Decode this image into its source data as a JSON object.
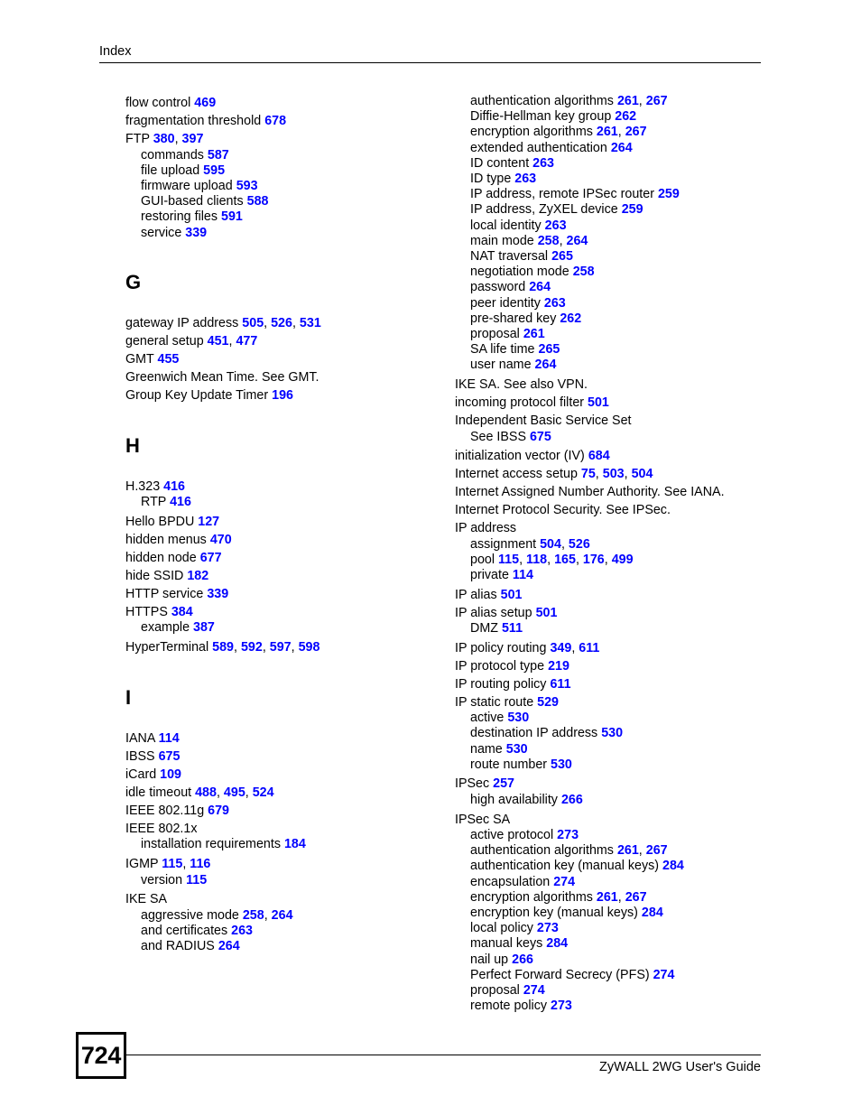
{
  "header": {
    "title": "Index"
  },
  "footer": {
    "page_number": "724",
    "guide_title": "ZyWALL 2WG User's Guide"
  },
  "colors": {
    "page_reference": "#0000FF",
    "text": "#000000",
    "background": "#FFFFFF"
  },
  "columns": [
    {
      "id": "left",
      "blocks": [
        {
          "type": "entries",
          "entries": [
            {
              "level": 0,
              "text": "flow control",
              "pages": [
                "469"
              ]
            },
            {
              "level": 0,
              "text": "fragmentation threshold",
              "pages": [
                "678"
              ]
            },
            {
              "level": 0,
              "text": "FTP",
              "pages": [
                "380",
                "397"
              ]
            },
            {
              "level": 1,
              "text": "commands",
              "pages": [
                "587"
              ]
            },
            {
              "level": 1,
              "text": "file upload",
              "pages": [
                "595"
              ]
            },
            {
              "level": 1,
              "text": "firmware upload",
              "pages": [
                "593"
              ]
            },
            {
              "level": 1,
              "text": "GUI-based clients",
              "pages": [
                "588"
              ]
            },
            {
              "level": 1,
              "text": "restoring files",
              "pages": [
                "591"
              ]
            },
            {
              "level": 1,
              "text": "service",
              "pages": [
                "339"
              ]
            }
          ]
        },
        {
          "type": "letter",
          "letter": "G",
          "entries": [
            {
              "level": 0,
              "text": "gateway IP address",
              "pages": [
                "505",
                "526",
                "531"
              ]
            },
            {
              "level": 0,
              "text": "general setup",
              "pages": [
                "451",
                "477"
              ]
            },
            {
              "level": 0,
              "text": "GMT",
              "pages": [
                "455"
              ]
            },
            {
              "level": 0,
              "text": "Greenwich Mean Time. See GMT.",
              "pages": []
            },
            {
              "level": 0,
              "text": "Group Key Update Timer",
              "pages": [
                "196"
              ]
            }
          ]
        },
        {
          "type": "letter",
          "letter": "H",
          "entries": [
            {
              "level": 0,
              "text": "H.323",
              "pages": [
                "416"
              ]
            },
            {
              "level": 1,
              "text": "RTP",
              "pages": [
                "416"
              ]
            },
            {
              "level": 0,
              "text": "Hello BPDU",
              "pages": [
                "127"
              ]
            },
            {
              "level": 0,
              "text": "hidden menus",
              "pages": [
                "470"
              ]
            },
            {
              "level": 0,
              "text": "hidden node",
              "pages": [
                "677"
              ]
            },
            {
              "level": 0,
              "text": "hide SSID",
              "pages": [
                "182"
              ]
            },
            {
              "level": 0,
              "text": "HTTP service",
              "pages": [
                "339"
              ]
            },
            {
              "level": 0,
              "text": "HTTPS",
              "pages": [
                "384"
              ]
            },
            {
              "level": 1,
              "text": "example",
              "pages": [
                "387"
              ]
            },
            {
              "level": 0,
              "text": "HyperTerminal",
              "pages": [
                "589",
                "592",
                "597",
                "598"
              ]
            }
          ]
        },
        {
          "type": "letter",
          "letter": "I",
          "entries": [
            {
              "level": 0,
              "text": "IANA",
              "pages": [
                "114"
              ]
            },
            {
              "level": 0,
              "text": "IBSS",
              "pages": [
                "675"
              ]
            },
            {
              "level": 0,
              "text": "iCard",
              "pages": [
                "109"
              ]
            },
            {
              "level": 0,
              "text": "idle timeout",
              "pages": [
                "488",
                "495",
                "524"
              ]
            },
            {
              "level": 0,
              "text": "IEEE 802.11g",
              "pages": [
                "679"
              ]
            },
            {
              "level": 0,
              "text": "IEEE 802.1x",
              "pages": []
            },
            {
              "level": 1,
              "text": "installation requirements",
              "pages": [
                "184"
              ]
            },
            {
              "level": 0,
              "text": "IGMP",
              "pages": [
                "115",
                "116"
              ]
            },
            {
              "level": 1,
              "text": "version",
              "pages": [
                "115"
              ]
            },
            {
              "level": 0,
              "text": "IKE SA",
              "pages": []
            },
            {
              "level": 1,
              "text": "aggressive mode",
              "pages": [
                "258",
                "264"
              ]
            },
            {
              "level": 1,
              "text": "and certificates",
              "pages": [
                "263"
              ]
            },
            {
              "level": 1,
              "text": "and RADIUS",
              "pages": [
                "264"
              ]
            }
          ]
        }
      ]
    },
    {
      "id": "right",
      "blocks": [
        {
          "type": "entries",
          "entries": [
            {
              "level": 1,
              "text": "authentication algorithms",
              "pages": [
                "261",
                "267"
              ]
            },
            {
              "level": 1,
              "text": "Diffie-Hellman key group",
              "pages": [
                "262"
              ]
            },
            {
              "level": 1,
              "text": "encryption algorithms",
              "pages": [
                "261",
                "267"
              ]
            },
            {
              "level": 1,
              "text": "extended authentication",
              "pages": [
                "264"
              ]
            },
            {
              "level": 1,
              "text": "ID content",
              "pages": [
                "263"
              ]
            },
            {
              "level": 1,
              "text": "ID type",
              "pages": [
                "263"
              ]
            },
            {
              "level": 1,
              "text": "IP address, remote IPSec router",
              "pages": [
                "259"
              ]
            },
            {
              "level": 1,
              "text": "IP address, ZyXEL device",
              "pages": [
                "259"
              ]
            },
            {
              "level": 1,
              "text": "local identity",
              "pages": [
                "263"
              ]
            },
            {
              "level": 1,
              "text": "main mode",
              "pages": [
                "258",
                "264"
              ]
            },
            {
              "level": 1,
              "text": "NAT traversal",
              "pages": [
                "265"
              ]
            },
            {
              "level": 1,
              "text": "negotiation mode",
              "pages": [
                "258"
              ]
            },
            {
              "level": 1,
              "text": "password",
              "pages": [
                "264"
              ]
            },
            {
              "level": 1,
              "text": "peer identity",
              "pages": [
                "263"
              ]
            },
            {
              "level": 1,
              "text": "pre-shared key",
              "pages": [
                "262"
              ]
            },
            {
              "level": 1,
              "text": "proposal",
              "pages": [
                "261"
              ]
            },
            {
              "level": 1,
              "text": "SA life time",
              "pages": [
                "265"
              ]
            },
            {
              "level": 1,
              "text": "user name",
              "pages": [
                "264"
              ]
            },
            {
              "level": 0,
              "text": "IKE SA. See also VPN.",
              "pages": []
            },
            {
              "level": 0,
              "text": "incoming protocol filter",
              "pages": [
                "501"
              ]
            },
            {
              "level": 0,
              "text": "Independent Basic Service Set",
              "pages": []
            },
            {
              "level": 1,
              "text": "See IBSS",
              "pages": [
                "675"
              ]
            },
            {
              "level": 0,
              "text": "initialization vector (IV)",
              "pages": [
                "684"
              ]
            },
            {
              "level": 0,
              "text": "Internet access setup",
              "pages": [
                "75",
                "503",
                "504"
              ]
            },
            {
              "level": 0,
              "text": "Internet Assigned Number Authority. See IANA.",
              "pages": []
            },
            {
              "level": 0,
              "text": "Internet Protocol Security. See IPSec.",
              "pages": []
            },
            {
              "level": 0,
              "text": "IP address",
              "pages": []
            },
            {
              "level": 1,
              "text": "assignment",
              "pages": [
                "504",
                "526"
              ]
            },
            {
              "level": 1,
              "text": "pool",
              "pages": [
                "115",
                "118",
                "165",
                "176",
                "499"
              ]
            },
            {
              "level": 1,
              "text": "private",
              "pages": [
                "114"
              ]
            },
            {
              "level": 0,
              "text": "IP alias",
              "pages": [
                "501"
              ]
            },
            {
              "level": 0,
              "text": "IP alias setup",
              "pages": [
                "501"
              ]
            },
            {
              "level": 1,
              "text": "DMZ",
              "pages": [
                "511"
              ]
            },
            {
              "level": 0,
              "text": "IP policy routing",
              "pages": [
                "349",
                "611"
              ]
            },
            {
              "level": 0,
              "text": "IP protocol type",
              "pages": [
                "219"
              ]
            },
            {
              "level": 0,
              "text": "IP routing policy",
              "pages": [
                "611"
              ]
            },
            {
              "level": 0,
              "text": "IP static route",
              "pages": [
                "529"
              ]
            },
            {
              "level": 1,
              "text": "active",
              "pages": [
                "530"
              ]
            },
            {
              "level": 1,
              "text": "destination IP address",
              "pages": [
                "530"
              ]
            },
            {
              "level": 1,
              "text": "name",
              "pages": [
                "530"
              ]
            },
            {
              "level": 1,
              "text": "route number",
              "pages": [
                "530"
              ]
            },
            {
              "level": 0,
              "text": "IPSec",
              "pages": [
                "257"
              ]
            },
            {
              "level": 1,
              "text": "high availability",
              "pages": [
                "266"
              ]
            },
            {
              "level": 0,
              "text": "IPSec SA",
              "pages": []
            },
            {
              "level": 1,
              "text": "active protocol",
              "pages": [
                "273"
              ]
            },
            {
              "level": 1,
              "text": "authentication algorithms",
              "pages": [
                "261",
                "267"
              ]
            },
            {
              "level": 1,
              "text": "authentication key (manual keys)",
              "pages": [
                "284"
              ]
            },
            {
              "level": 1,
              "text": "encapsulation",
              "pages": [
                "274"
              ]
            },
            {
              "level": 1,
              "text": "encryption algorithms",
              "pages": [
                "261",
                "267"
              ]
            },
            {
              "level": 1,
              "text": "encryption key (manual keys)",
              "pages": [
                "284"
              ]
            },
            {
              "level": 1,
              "text": "local policy",
              "pages": [
                "273"
              ]
            },
            {
              "level": 1,
              "text": "manual keys",
              "pages": [
                "284"
              ]
            },
            {
              "level": 1,
              "text": "nail up",
              "pages": [
                "266"
              ]
            },
            {
              "level": 1,
              "text": "Perfect Forward Secrecy (PFS)",
              "pages": [
                "274"
              ]
            },
            {
              "level": 1,
              "text": "proposal",
              "pages": [
                "274"
              ]
            },
            {
              "level": 1,
              "text": "remote policy",
              "pages": [
                "273"
              ]
            }
          ]
        }
      ]
    }
  ]
}
